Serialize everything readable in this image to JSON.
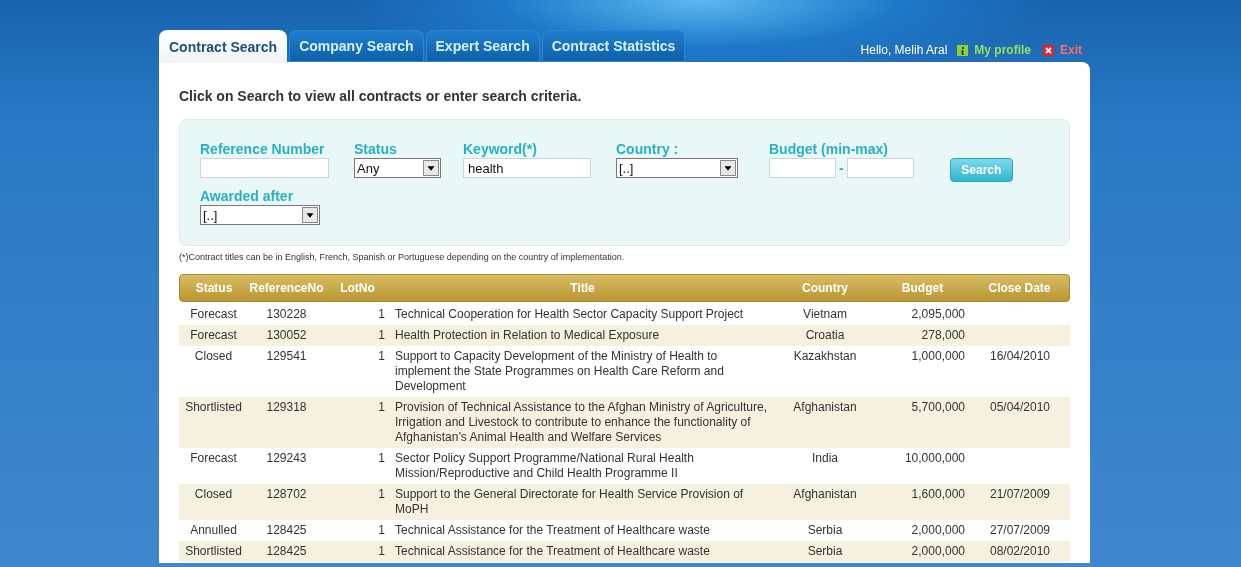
{
  "tabs": [
    {
      "label": "Contract Search",
      "selected": true
    },
    {
      "label": "Company Search",
      "selected": false
    },
    {
      "label": "Expert Search",
      "selected": false
    },
    {
      "label": "Contract Statistics",
      "selected": false
    }
  ],
  "user": {
    "greeting": "Hello, Melih Aral",
    "profile_link": "My profile",
    "exit_link": "Exit"
  },
  "heading": "Click on Search to view all contracts or enter search criteria.",
  "filters": [
    {
      "label": "Reference Number",
      "kind": "text"
    },
    {
      "label": "Status",
      "kind": "select",
      "value": "Any"
    },
    {
      "label": "Keyword(*)",
      "kind": "text",
      "value": "health"
    },
    {
      "label": "Country :",
      "kind": "select",
      "value": "[..]"
    },
    {
      "label": "Budget (min-max)",
      "kind": "range",
      "separator": "-"
    },
    {
      "label": "Awarded after",
      "kind": "select",
      "value": "[..]"
    }
  ],
  "search_button": "Search",
  "note": "(*)Contract titles can be in English, French, Spanish or Portuguese depending on the country of implementation.",
  "table": {
    "columns": [
      "Status",
      "ReferenceNo",
      "LotNo",
      "Title",
      "Country",
      "Budget",
      "Close Date"
    ],
    "rows": [
      [
        "Forecast",
        "130228",
        "1",
        "Technical Cooperation for Health Sector Capacity Support Project",
        "Vietnam",
        "2,095,000",
        null
      ],
      [
        "Forecast",
        "130052",
        "1",
        "Health Protection in Relation to Medical Exposure",
        "Croatia",
        "278,000",
        null
      ],
      [
        "Closed",
        "129541",
        "1",
        "Support to Capacity Development of the Ministry of Health to implement the State Programmes on Health Care Reform and Development",
        "Kazakhstan",
        "1,000,000",
        "16/04/2010"
      ],
      [
        "Shortlisted",
        "129318",
        "1",
        "Provision of Technical Assistance to the Afghan Ministry of Agriculture, Irrigation and Livestock to contribute to enhance the functionality of Afghanistan’s Animal Health and Welfare Services",
        "Afghanistan",
        "5,700,000",
        "05/04/2010"
      ],
      [
        "Forecast",
        "129243",
        "1",
        "Sector Policy Support Programme/National Rural Health Mission/Reproductive and Child Health Programme II",
        "India",
        "10,000,000",
        null
      ],
      [
        "Closed",
        "128702",
        "1",
        "Support to the General Directorate for Health Service Provision of MoPH",
        "Afghanistan",
        "1,600,000",
        "21/07/2009"
      ],
      [
        "Annulled",
        "128425",
        "1",
        "Technical Assistance for the Treatment of Healthcare waste",
        "Serbia",
        "2,000,000",
        "27/07/2009"
      ],
      [
        "Shortlisted",
        "128425",
        "1",
        "Technical Assistance for the Treatment of Healthcare waste",
        "Serbia",
        "2,000,000",
        "08/02/2010"
      ]
    ]
  }
}
